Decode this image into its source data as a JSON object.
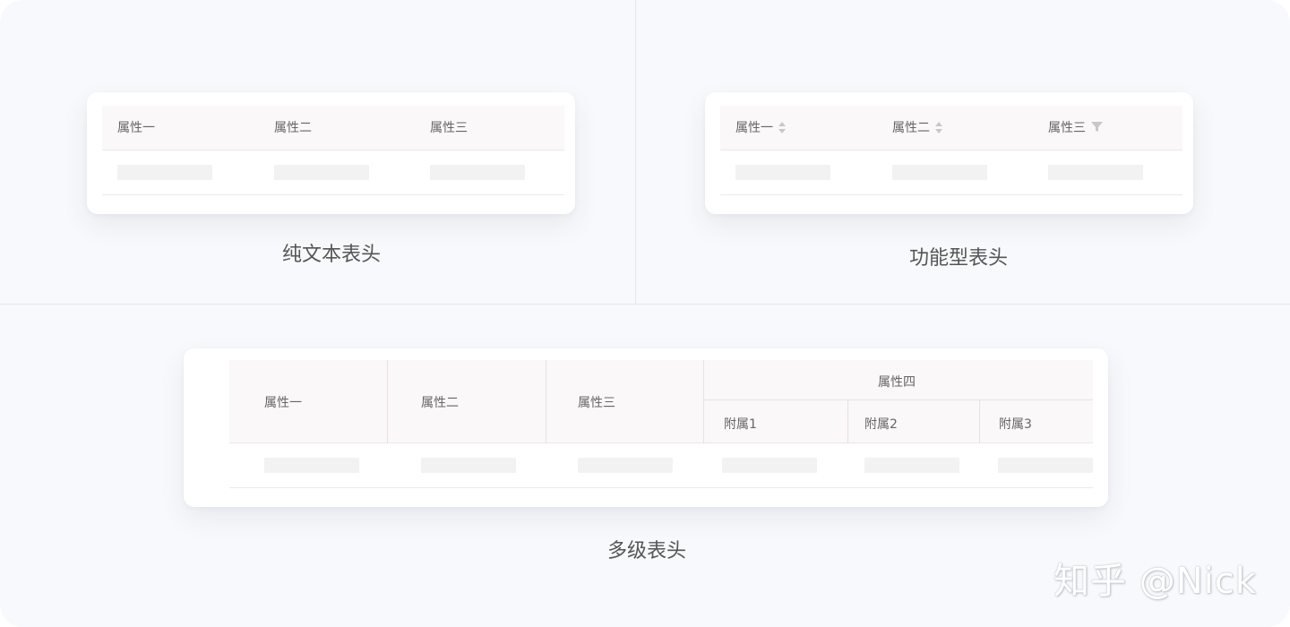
{
  "colors": {
    "background": "#f8f9fc",
    "card": "#ffffff",
    "header_bg": "#faf8f8",
    "skeleton": "#f2f2f2",
    "icon_gray": "#c8c8c8"
  },
  "panel_simple": {
    "columns": [
      "属性一",
      "属性二",
      "属性三"
    ],
    "caption": "纯文本表头"
  },
  "panel_functional": {
    "columns": [
      {
        "label": "属性一",
        "icon": "sort-icon"
      },
      {
        "label": "属性二",
        "icon": "sort-icon"
      },
      {
        "label": "属性三",
        "icon": "filter-icon"
      }
    ],
    "caption": "功能型表头"
  },
  "panel_multilevel": {
    "columns": [
      "属性一",
      "属性二",
      "属性三"
    ],
    "group_label": "属性四",
    "sub_columns": [
      "附属1",
      "附属2",
      "附属3"
    ],
    "caption": "多级表头"
  },
  "watermark": "知乎 @Nick"
}
